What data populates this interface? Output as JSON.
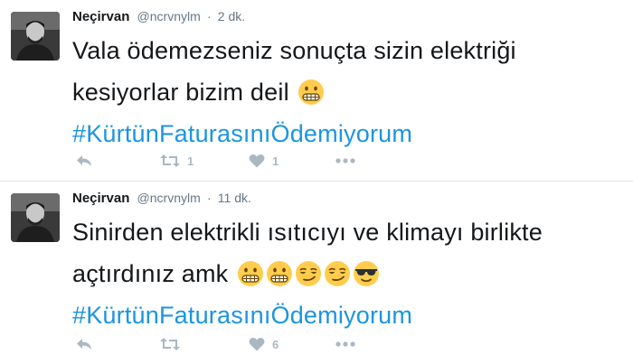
{
  "tweets": [
    {
      "name": "Neçirvan",
      "handle": "@ncrvnylm",
      "separator": "·",
      "time": "2 dk.",
      "text": "Vala ödemezseniz sonuçta sizin elektriği kesiyorlar bizim deil",
      "emojis": [
        "grimacing-emoji"
      ],
      "hashtag": "#KürtünFaturasınıÖdemiyorum",
      "retweets": "1",
      "likes": "1"
    },
    {
      "name": "Neçirvan",
      "handle": "@ncrvnylm",
      "separator": "·",
      "time": "11 dk.",
      "text": "Sinirden elektrikli ısıtıcıyı ve klimayı birlikte açtırdınız amk",
      "emojis": [
        "grimacing-emoji",
        "grimacing-emoji",
        "smirking-emoji",
        "smirking-emoji",
        "sunglasses-emoji"
      ],
      "hashtag": "#KürtünFaturasınıÖdemiyorum",
      "retweets": "",
      "likes": "6"
    }
  ],
  "icons": {
    "reply": "reply-icon",
    "retweet": "retweet-icon",
    "like": "heart-icon",
    "more": "more-dots-icon"
  },
  "colors": {
    "hashtag": "#1b95e0",
    "action_icon": "#aab8c2",
    "meta": "#657786",
    "emoji_face": "#ffcc4d"
  }
}
